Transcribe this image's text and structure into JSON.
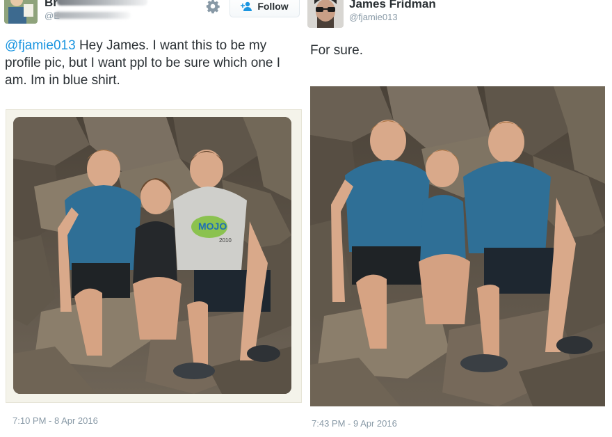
{
  "left_tweet": {
    "author_name": "Br",
    "author_handle": "@E",
    "follow_label": "Follow",
    "mention": "@fjamie013",
    "text": " Hey James. I want this to be my profile pic, but I want ppl to be sure which one I am. Im in blue shirt.",
    "photo_shirt_text": "MOJO",
    "photo_shirt_year": "2010",
    "timestamp": "7:10 PM - 8 Apr 2016"
  },
  "right_tweet": {
    "author_name": "James Fridman",
    "author_handle": "@fjamie013",
    "text": "For sure.",
    "timestamp": "7:43 PM - 9 Apr 2016"
  },
  "colors": {
    "link": "#1b95e0",
    "meta_text": "#8899a6",
    "body_text": "#292f33",
    "blue_shirt": "#2f6f96",
    "rocks": "#6b6156"
  },
  "icons": [
    "gear-icon",
    "follow-person-icon"
  ]
}
